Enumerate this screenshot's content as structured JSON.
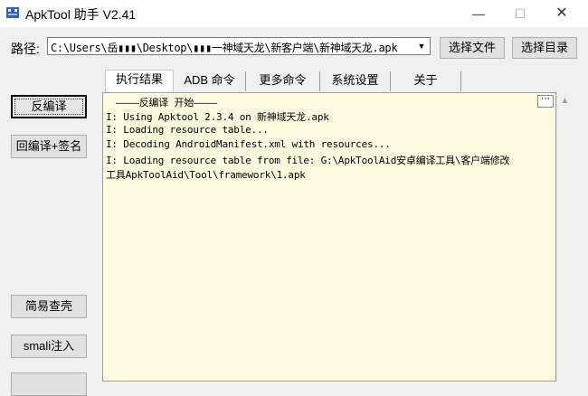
{
  "window": {
    "title": "ApkTool 助手 V2.41",
    "minimize_glyph": "—",
    "maximize_glyph": "☐",
    "close_glyph": "✕"
  },
  "path": {
    "label": "路径:",
    "value": "C:\\Users\\岳▮▮▮\\Desktop\\▮▮▮一神域天龙\\新客户端\\新神域天龙.apk",
    "select_file_label": "选择文件",
    "select_dir_label": "选择目录"
  },
  "sidebar": {
    "decompile_label": "反编译",
    "recompile_sign_label": "回编译+签名",
    "simple_shell_label": "简易查壳",
    "smali_inject_label": "smali注入"
  },
  "tabs": [
    {
      "label": "执行结果",
      "active": true
    },
    {
      "label": "ADB 命令"
    },
    {
      "label": "更多命令"
    },
    {
      "label": "系统设置"
    },
    {
      "label": "关于"
    }
  ],
  "output": {
    "lines": [
      "————反编译 开始————",
      "I: Using Apktool 2.3.4 on 新神域天龙.apk",
      "I: Loading resource table...",
      "I: Decoding AndroidManifest.xml with resources...",
      "I: Loading resource table from file: G:\\ApkToolAid安卓编译工具\\客户端修改",
      "工具ApkToolAid\\Tool\\framework\\1.apk"
    ],
    "more_glyph": "⋯"
  },
  "icons": {
    "app": "apktool-logo-icon",
    "combo_arrow": "chevron-down-icon",
    "scroll_up": "scroll-up-arrow-icon"
  }
}
